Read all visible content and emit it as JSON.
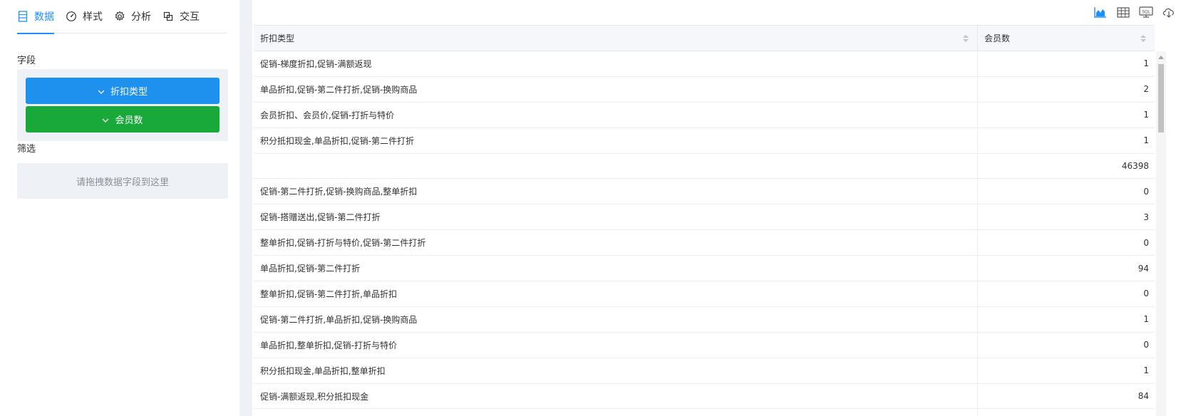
{
  "tabs": [
    {
      "label": "数据",
      "icon": "data-list-icon",
      "active": true
    },
    {
      "label": "样式",
      "icon": "gauge-icon",
      "active": false
    },
    {
      "label": "分析",
      "icon": "gear-icon",
      "active": false
    },
    {
      "label": "交互",
      "icon": "copy-icon",
      "active": false
    }
  ],
  "fields_label": "字段",
  "fields": [
    {
      "label": "折扣类型",
      "color": "#1e90ee"
    },
    {
      "label": "会员数",
      "color": "#19a93a"
    }
  ],
  "filter_label": "筛选",
  "filter_placeholder": "请拖拽数据字段到这里",
  "toolbar": [
    "area-chart-icon",
    "table-icon",
    "sql-icon",
    "cloud-download-icon"
  ],
  "table": {
    "columns": [
      "折扣类型",
      "会员数"
    ],
    "rows": [
      [
        "促销-梯度折扣,促销-满额返现",
        "1"
      ],
      [
        "单品折扣,促销-第二件打折,促销-换购商品",
        "2"
      ],
      [
        "会员折扣、会员价,促销-打折与特价",
        "1"
      ],
      [
        "积分抵扣现金,单品折扣,促销-第二件打折",
        "1"
      ],
      [
        "",
        "46398"
      ],
      [
        "促销-第二件打折,促销-换购商品,整单折扣",
        "0"
      ],
      [
        "促销-搭赠送出,促销-第二件打折",
        "3"
      ],
      [
        "整单折扣,促销-打折与特价,促销-第二件打折",
        "0"
      ],
      [
        "单品折扣,促销-第二件打折",
        "94"
      ],
      [
        "整单折扣,促销-第二件打折,单品折扣",
        "0"
      ],
      [
        "促销-第二件打折,单品折扣,促销-换购商品",
        "1"
      ],
      [
        "单品折扣,整单折扣,促销-打折与特价",
        "0"
      ],
      [
        "积分抵扣现金,单品折扣,整单折扣",
        "1"
      ],
      [
        "促销-满额返现,积分抵扣现金",
        "84"
      ],
      [
        "",
        ""
      ]
    ]
  },
  "colors": {
    "accent": "#1e90ff",
    "blue_field": "#1e90ee",
    "green_field": "#19a93a"
  }
}
